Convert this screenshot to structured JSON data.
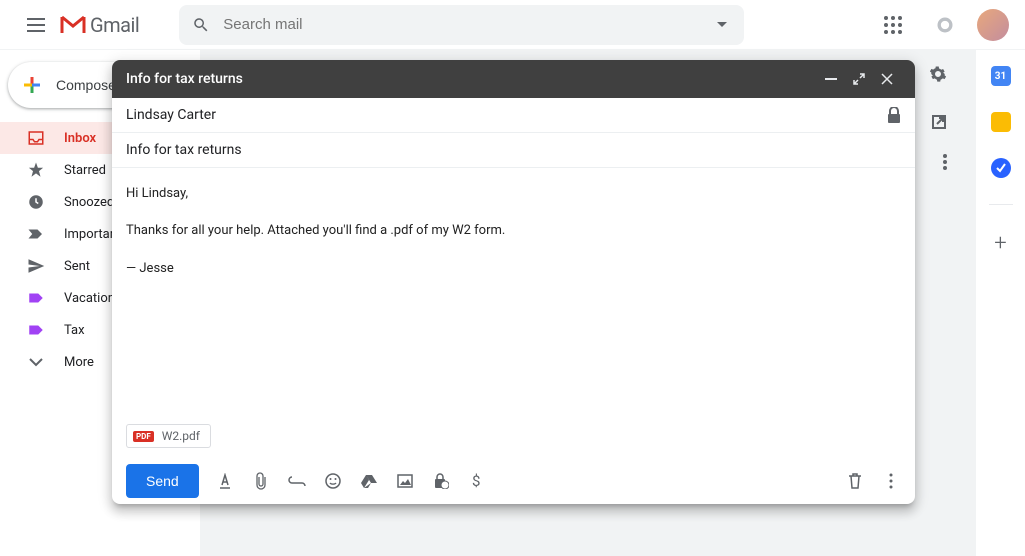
{
  "header": {
    "logo_text": "Gmail",
    "search_placeholder": "Search mail"
  },
  "sidebar": {
    "compose_label": "Compose",
    "items": [
      {
        "label": "Inbox",
        "icon": "inbox",
        "active": true
      },
      {
        "label": "Starred",
        "icon": "star",
        "active": false
      },
      {
        "label": "Snoozed",
        "icon": "clock",
        "active": false
      },
      {
        "label": "Important",
        "icon": "important",
        "active": false
      },
      {
        "label": "Sent",
        "icon": "send",
        "active": false
      },
      {
        "label": "Vacation",
        "icon": "label",
        "active": false
      },
      {
        "label": "Tax",
        "icon": "label",
        "active": false
      },
      {
        "label": "More",
        "icon": "expand",
        "active": false
      }
    ]
  },
  "right_panel": {
    "calendar_day": "31"
  },
  "compose": {
    "title": "Info for tax returns",
    "recipient": "Lindsay Carter",
    "subject": "Info for tax returns",
    "body_lines": [
      "Hi Lindsay,",
      "Thanks for all your help. Attached you'll find a .pdf of my W2 form.",
      "— Jesse"
    ],
    "attachment": {
      "name": "W2.pdf",
      "type_badge": "PDF"
    },
    "send_label": "Send"
  }
}
